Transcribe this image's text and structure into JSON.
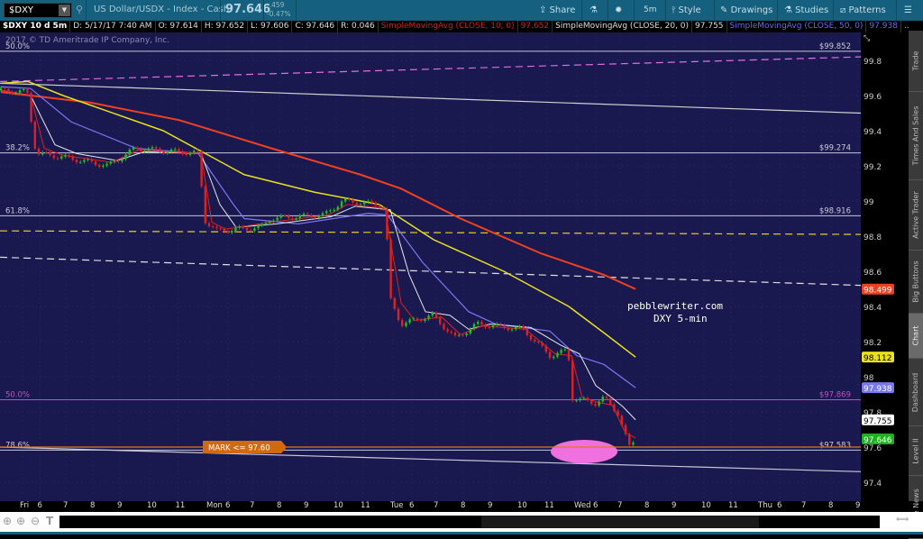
{
  "toolbar": {
    "symbol": "$DXY",
    "description": "US Dollar/USDX - Index - Cash",
    "last": "97.646",
    "net_change": "-.459",
    "pct_change": "-0.47%",
    "share": "Share",
    "timeframe": "5m",
    "style": "Style",
    "drawings": "Drawings",
    "studies": "Studies",
    "patterns": "Patterns"
  },
  "info": {
    "title": "$DXY 10 d 5m",
    "date": "D: 5/17/17 7:40 AM",
    "open": "O: 97.614",
    "high": "H: 97.652",
    "low": "L: 97.606",
    "close": "C: 97.646",
    "range": "R: 0.046",
    "sma10_label": "SimpleMovingAvg (CLOSE, 10, 0)",
    "sma10_value": "97.652",
    "sma20_label": "SimpleMovingAvg (CLOSE, 20, 0)",
    "sma20_value": "97.755",
    "sma50_label": "SimpleMovingAvg (CLOSE, 50, 0)",
    "sma50_value": "97.938",
    "more": "..."
  },
  "copyright": "2017 © TD Ameritrade IP Company, Inc.",
  "annotation": {
    "line1": "pebblewriter.com",
    "line2": "DXY 5-min"
  },
  "mark_label": "MARK <= 97.60",
  "sidebar": [
    {
      "label": "Trade",
      "active": false
    },
    {
      "label": "Times And Sales",
      "active": false
    },
    {
      "label": "Active Trader",
      "active": false
    },
    {
      "label": "Big Buttons",
      "active": false
    },
    {
      "label": "Chart",
      "active": true
    },
    {
      "label": "Dashboard",
      "active": false
    },
    {
      "label": "Level II",
      "active": false
    },
    {
      "label": "Live News",
      "active": false
    }
  ],
  "chart_data": {
    "type": "line",
    "title": "$DXY 10 d 5m",
    "ylim": [
      97.25,
      99.98
    ],
    "y_ticks": [
      "99.8",
      "99.6",
      "99.4",
      "99.2",
      "99",
      "98.8",
      "98.6",
      "98.4",
      "98.2",
      "98",
      "97.8",
      "97.6",
      "97.4"
    ],
    "x_ticks": [
      {
        "label": "Fri",
        "u": 0
      },
      {
        "label": "6",
        "u": 0.65
      },
      {
        "label": "7",
        "u": 1.6
      },
      {
        "label": "8",
        "u": 2.6
      },
      {
        "label": "9",
        "u": 3.6
      },
      {
        "label": "10",
        "u": 4.7
      },
      {
        "label": "11",
        "u": 5.75
      },
      {
        "label": "Mon",
        "u": 6.9
      },
      {
        "label": "6",
        "u": 7.6
      },
      {
        "label": "7",
        "u": 8.5
      },
      {
        "label": "8",
        "u": 9.5
      },
      {
        "label": "9",
        "u": 10.5
      },
      {
        "label": "10",
        "u": 11.6
      },
      {
        "label": "11",
        "u": 12.6
      },
      {
        "label": "Tue",
        "u": 13.7
      },
      {
        "label": "6",
        "u": 14.4
      },
      {
        "label": "7",
        "u": 15.3
      },
      {
        "label": "8",
        "u": 16.3
      },
      {
        "label": "9",
        "u": 17.3
      },
      {
        "label": "10",
        "u": 18.4
      },
      {
        "label": "11",
        "u": 19.4
      },
      {
        "label": "Wed",
        "u": 20.5
      },
      {
        "label": "6",
        "u": 21.2
      },
      {
        "label": "7",
        "u": 22.1
      },
      {
        "label": "8",
        "u": 23.1
      },
      {
        "label": "9",
        "u": 24.1
      },
      {
        "label": "10",
        "u": 25.2
      },
      {
        "label": "11",
        "u": 26.2
      },
      {
        "label": "Thu",
        "u": 27.3
      },
      {
        "label": "6",
        "u": 28,
        "_": 0
      },
      {
        "label": "7",
        "u": 28.9
      },
      {
        "label": "8",
        "u": 29.9
      },
      {
        "label": "9",
        "u": 30.9
      }
    ],
    "price": [
      [
        -0.8,
        99.63
      ],
      [
        0.17,
        99.62
      ],
      [
        0.5,
        99.27
      ],
      [
        1.5,
        99.25
      ],
      [
        3.17,
        99.2
      ],
      [
        4.17,
        99.3
      ],
      [
        6.57,
        99.27
      ],
      [
        6.67,
        98.9
      ],
      [
        7.17,
        98.83
      ],
      [
        8.83,
        98.85
      ],
      [
        9.17,
        98.9
      ],
      [
        11.17,
        98.92
      ],
      [
        11.83,
        99.0
      ],
      [
        13.17,
        98.98
      ],
      [
        13.43,
        98.95
      ],
      [
        13.57,
        98.45
      ],
      [
        14,
        98.3
      ],
      [
        15.17,
        98.35
      ],
      [
        16,
        98.22
      ],
      [
        16.83,
        98.3
      ],
      [
        18.5,
        98.27
      ],
      [
        19.5,
        98.12
      ],
      [
        20.17,
        98.15
      ],
      [
        20.33,
        97.88
      ],
      [
        21.17,
        97.85
      ],
      [
        21.5,
        97.88
      ],
      [
        22,
        97.8
      ],
      [
        22.43,
        97.6
      ],
      [
        22.67,
        97.646
      ]
    ],
    "series": [
      {
        "name": "SMA 10",
        "color": "#e02020",
        "width": 1,
        "values": [
          [
            -0.8,
            99.63
          ],
          [
            0.3,
            99.6
          ],
          [
            0.8,
            99.3
          ],
          [
            1.5,
            99.26
          ],
          [
            3.3,
            99.22
          ],
          [
            4.3,
            99.29
          ],
          [
            6.6,
            99.27
          ],
          [
            7.0,
            98.88
          ],
          [
            7.5,
            98.84
          ],
          [
            9.2,
            98.88
          ],
          [
            11.3,
            98.92
          ],
          [
            12,
            98.98
          ],
          [
            13.4,
            98.96
          ],
          [
            14.0,
            98.42
          ],
          [
            14.5,
            98.32
          ],
          [
            15.5,
            98.34
          ],
          [
            16.2,
            98.24
          ],
          [
            17,
            98.29
          ],
          [
            18.6,
            98.27
          ],
          [
            19.7,
            98.13
          ],
          [
            20.3,
            98.12
          ],
          [
            20.7,
            97.88
          ],
          [
            21.4,
            97.85
          ],
          [
            21.8,
            97.84
          ],
          [
            22.3,
            97.68
          ],
          [
            22.67,
            97.652
          ]
        ]
      },
      {
        "name": "SMA 20",
        "color": "#e8e8e8",
        "width": 1,
        "values": [
          [
            -0.8,
            99.63
          ],
          [
            0.3,
            99.6
          ],
          [
            1.2,
            99.32
          ],
          [
            2,
            99.27
          ],
          [
            3.5,
            99.23
          ],
          [
            4.5,
            99.28
          ],
          [
            6.6,
            99.27
          ],
          [
            7.3,
            98.98
          ],
          [
            7.9,
            98.85
          ],
          [
            9.4,
            98.87
          ],
          [
            11.4,
            98.91
          ],
          [
            12.3,
            98.97
          ],
          [
            13.6,
            98.95
          ],
          [
            14.3,
            98.58
          ],
          [
            14.9,
            98.37
          ],
          [
            15.8,
            98.35
          ],
          [
            16.5,
            98.27
          ],
          [
            17.3,
            98.3
          ],
          [
            18.8,
            98.28
          ],
          [
            19.9,
            98.18
          ],
          [
            20.6,
            98.13
          ],
          [
            21.2,
            97.95
          ],
          [
            21.8,
            97.88
          ],
          [
            22.2,
            97.83
          ],
          [
            22.67,
            97.755
          ]
        ]
      },
      {
        "name": "SMA 50",
        "color": "#7a78f0",
        "width": 1.2,
        "values": [
          [
            -0.8,
            99.65
          ],
          [
            0.3,
            99.64
          ],
          [
            1.8,
            99.45
          ],
          [
            4.2,
            99.3
          ],
          [
            6.5,
            99.27
          ],
          [
            7.8,
            98.98
          ],
          [
            8.2,
            98.9
          ],
          [
            10.2,
            98.87
          ],
          [
            12.8,
            98.93
          ],
          [
            13.5,
            98.92
          ],
          [
            14.8,
            98.65
          ],
          [
            16.5,
            98.37
          ],
          [
            17.5,
            98.3
          ],
          [
            19.5,
            98.26
          ],
          [
            20.5,
            98.12
          ],
          [
            21.5,
            98.07
          ],
          [
            22.67,
            97.938
          ]
        ]
      },
      {
        "name": "SMA 100",
        "color": "#e8e020",
        "width": 1.5,
        "values": [
          [
            -0.8,
            99.67
          ],
          [
            0.2,
            99.68
          ],
          [
            1.5,
            99.6
          ],
          [
            5.2,
            99.4
          ],
          [
            8.2,
            99.15
          ],
          [
            10.8,
            99.05
          ],
          [
            13.2,
            98.98
          ],
          [
            14.2,
            98.88
          ],
          [
            15.2,
            98.78
          ],
          [
            17.8,
            98.6
          ],
          [
            20.2,
            98.4
          ],
          [
            21.5,
            98.25
          ],
          [
            22.67,
            98.112
          ]
        ]
      },
      {
        "name": "SMA 200",
        "color": "#f04020",
        "width": 2,
        "values": [
          [
            -0.8,
            99.62
          ],
          [
            2.5,
            99.56
          ],
          [
            5.8,
            99.46
          ],
          [
            9.2,
            99.3
          ],
          [
            12.5,
            99.15
          ],
          [
            14,
            99.07
          ],
          [
            16.2,
            98.9
          ],
          [
            19.2,
            98.7
          ],
          [
            21.5,
            98.58
          ],
          [
            22.67,
            98.499
          ]
        ]
      }
    ],
    "fib_levels": [
      {
        "pct": "50.0%",
        "value": 99.852,
        "label": "$99.852",
        "color": "#c8c8d8"
      },
      {
        "pct": "38.2%",
        "value": 99.274,
        "label": "$99.274",
        "color": "#c8c8d8"
      },
      {
        "pct": "61.8%",
        "value": 98.916,
        "label": "$98.916",
        "color": "#c8c8d8"
      },
      {
        "pct": "50.0%",
        "value": 97.869,
        "label": "$97.869",
        "color": "#c050c0"
      },
      {
        "pct": "78.6%",
        "value": 97.583,
        "label": "$97.583",
        "color": "#c8c8d8"
      }
    ],
    "trendlines": [
      {
        "from": [
          -0.83,
          99.68
        ],
        "to": [
          31,
          99.82
        ],
        "color": "#e070e0",
        "dash": true
      },
      {
        "from": [
          -0.83,
          99.67
        ],
        "to": [
          31,
          99.5
        ],
        "color": "#d0d0d0",
        "dash": false
      },
      {
        "from": [
          -0.83,
          98.83
        ],
        "to": [
          31,
          98.81
        ],
        "color": "#e8d020",
        "dash": true
      },
      {
        "from": [
          -0.83,
          98.68
        ],
        "to": [
          31,
          98.52
        ],
        "color": "#e0e0e0",
        "dash": true
      },
      {
        "from": [
          -0.83,
          97.6
        ],
        "to": [
          31,
          97.46
        ],
        "color": "#c8c8d8",
        "dash": false
      }
    ],
    "mark_level": 97.6,
    "price_badges": [
      {
        "value": 98.499,
        "label": "98.499",
        "bg": "#f04020",
        "fg": "#fff"
      },
      {
        "value": 98.112,
        "label": "98.112",
        "bg": "#e8e020",
        "fg": "#000"
      },
      {
        "value": 97.938,
        "label": "97.938",
        "bg": "#7a78f0",
        "fg": "#fff"
      },
      {
        "value": 97.755,
        "label": "97.755",
        "bg": "#ffffff",
        "fg": "#000"
      },
      {
        "value": 97.646,
        "label": "97.646",
        "bg": "#20b020",
        "fg": "#fff"
      }
    ]
  }
}
